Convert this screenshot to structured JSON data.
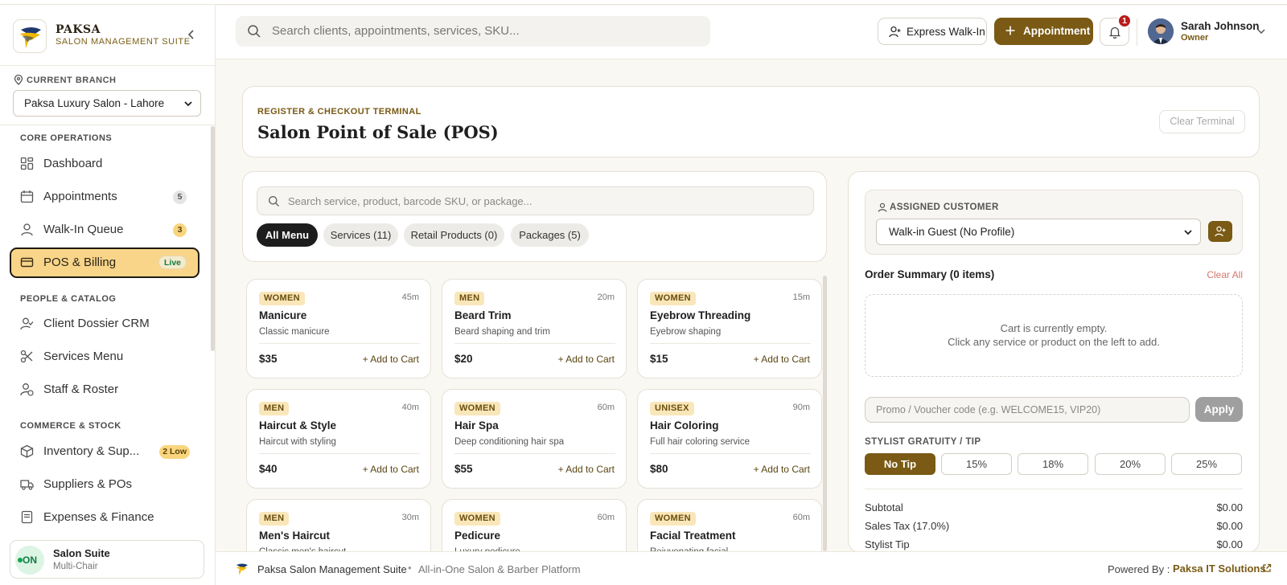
{
  "brand": {
    "name": "PAKSA",
    "subtitle": "SALON MANAGEMENT SUITE"
  },
  "branch": {
    "label": "CURRENT BRANCH",
    "selected": "Paksa Luxury Salon - Lahore"
  },
  "nav": {
    "core_label": "CORE OPERATIONS",
    "people_label": "PEOPLE & CATALOG",
    "commerce_label": "COMMERCE & STOCK",
    "items": [
      {
        "label": "Dashboard",
        "icon": "grid-icon"
      },
      {
        "label": "Appointments",
        "icon": "calendar-icon",
        "badge": "5"
      },
      {
        "label": "Walk-In Queue",
        "icon": "user-icon",
        "badge": "3"
      },
      {
        "label": "POS & Billing",
        "icon": "card-icon",
        "badge": "Live"
      },
      {
        "label": "Client Dossier CRM",
        "icon": "user-check-icon"
      },
      {
        "label": "Services Menu",
        "icon": "scissors-icon"
      },
      {
        "label": "Staff & Roster",
        "icon": "user-clock-icon"
      },
      {
        "label": "Inventory & Sup...",
        "icon": "box-icon",
        "badge": "2 Low"
      },
      {
        "label": "Suppliers & POs",
        "icon": "truck-icon"
      },
      {
        "label": "Expenses & Finance",
        "icon": "receipt-icon"
      }
    ]
  },
  "sidebar_footer": {
    "status": "ON",
    "title": "Salon Suite",
    "subtitle": "Multi-Chair"
  },
  "topbar": {
    "search_placeholder": "Search clients, appointments, services, SKU...",
    "walkin_label": "Express Walk-In",
    "appointment_label": "Appointment",
    "notifications_count": "1",
    "user_name": "Sarah Johnson",
    "user_role": "Owner"
  },
  "pos": {
    "kicker": "REGISTER & CHECKOUT TERMINAL",
    "title": "Salon Point of Sale (POS)",
    "clear_terminal": "Clear Terminal"
  },
  "catalog": {
    "search_placeholder": "Search service, product, barcode SKU, or package...",
    "filters": [
      "All Menu",
      "Services (11)",
      "Retail Products (0)",
      "Packages (5)"
    ],
    "add_label": "+ Add to Cart",
    "items": [
      {
        "tag": "WOMEN",
        "duration": "45m",
        "name": "Manicure",
        "desc": "Classic manicure",
        "price": "$35"
      },
      {
        "tag": "MEN",
        "duration": "20m",
        "name": "Beard Trim",
        "desc": "Beard shaping and trim",
        "price": "$20"
      },
      {
        "tag": "WOMEN",
        "duration": "15m",
        "name": "Eyebrow Threading",
        "desc": "Eyebrow shaping",
        "price": "$15"
      },
      {
        "tag": "MEN",
        "duration": "40m",
        "name": "Haircut & Style",
        "desc": "Haircut with styling",
        "price": "$40"
      },
      {
        "tag": "WOMEN",
        "duration": "60m",
        "name": "Hair Spa",
        "desc": "Deep conditioning hair spa",
        "price": "$55"
      },
      {
        "tag": "UNISEX",
        "duration": "90m",
        "name": "Hair Coloring",
        "desc": "Full hair coloring service",
        "price": "$80"
      },
      {
        "tag": "MEN",
        "duration": "30m",
        "name": "Men's Haircut",
        "desc": "Classic men's haircut",
        "price": ""
      },
      {
        "tag": "WOMEN",
        "duration": "60m",
        "name": "Pedicure",
        "desc": "Luxury pedicure",
        "price": ""
      },
      {
        "tag": "WOMEN",
        "duration": "60m",
        "name": "Facial Treatment",
        "desc": "Rejuvenating facial",
        "price": ""
      }
    ]
  },
  "order": {
    "customer_label": "ASSIGNED CUSTOMER",
    "customer_selected": "Walk-in Guest (No Profile)",
    "summary_title": "Order Summary (0 items)",
    "clear_all": "Clear All",
    "empty_line1": "Cart is currently empty.",
    "empty_line2": "Click any service or product on the left to add.",
    "promo_placeholder": "Promo / Voucher code (e.g. WELCOME15, VIP20)",
    "apply_label": "Apply",
    "tip_label": "STYLIST GRATUITY / TIP",
    "tips": [
      "No Tip",
      "15%",
      "18%",
      "20%",
      "25%"
    ],
    "totals": [
      {
        "label": "Subtotal",
        "value": "$0.00"
      },
      {
        "label": "Sales Tax (17.0%)",
        "value": "$0.00"
      },
      {
        "label": "Stylist Tip",
        "value": "$0.00"
      }
    ]
  },
  "footer": {
    "name": "Paksa Salon Management Suite",
    "separator": "•",
    "tagline": "All-in-One Salon & Barber Platform",
    "powered_label": "Powered By :",
    "company": "Paksa IT Solutions"
  },
  "colors": {
    "accent": "#7a5a14",
    "active_nav": "#f9d58a",
    "danger": "#b91c1c"
  }
}
